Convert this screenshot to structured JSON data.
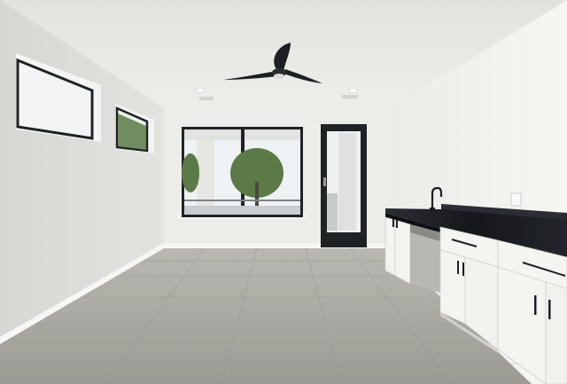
{
  "scene": {
    "colors": {
      "ceiling": "#e9e9e7",
      "back_wall": "#ecece9",
      "left_wall": "#e2e2df",
      "right_wall": "#f0f0ed",
      "floor": "#a9a8a1",
      "window_frame": "#1f2326",
      "countertop": "#1b1d22",
      "cabinet": "#f3f3f0",
      "sky": "#f1f4f6",
      "tree": "#5b7a45"
    },
    "icons": {
      "fan": "ceiling-fan-icon",
      "faucet": "faucet-icon",
      "outlet": "outlet-icon"
    }
  }
}
